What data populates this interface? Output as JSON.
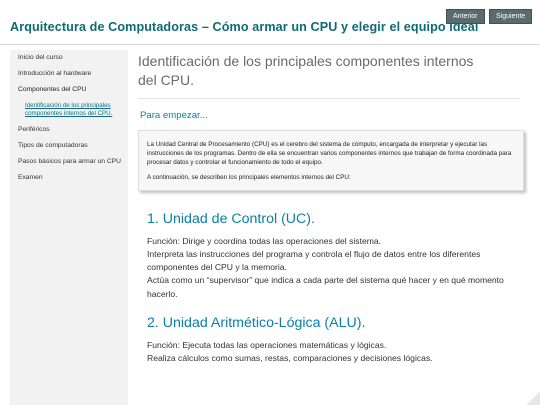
{
  "header": {
    "title": "Arquitectura de Computadoras – Cómo armar un CPU y elegir el equipo ideal",
    "prev_label": "Anterior",
    "next_label": "Siguiente"
  },
  "sidebar": {
    "items": [
      {
        "label": "Inicio del curso"
      },
      {
        "label": "Introducción al hardware"
      },
      {
        "label": "Componentes del CPU"
      },
      {
        "label": "Identificación de los principales componentes internos del CPU."
      },
      {
        "label": "Periféricos"
      },
      {
        "label": "Tipos de computadoras"
      },
      {
        "label": "Pasos básicos para armar un CPU"
      },
      {
        "label": "Examen"
      }
    ]
  },
  "main": {
    "page_title": "Identificación de los principales componentes internos del CPU.",
    "start_heading": "Para empezar...",
    "intro": [
      "La Unidad Central de Procesamiento (CPU) es el cerebro del sistema de cómputo, encargada de interpretar y ejecutar las instrucciones de los programas. Dentro de ella se encuentran varios componentes internos que trabajan de forma coordinada para procesar datos y controlar el funcionamiento de todo el equipo.",
      "A continuación, se describen los principales elementos internos del CPU:"
    ],
    "sections": [
      {
        "heading": "1. Unidad de Control (UC).",
        "lines": [
          "Función: Dirige y coordina todas las operaciones del sistema.",
          "Interpreta las instrucciones del programa y controla el flujo de datos entre los diferentes componentes del CPU y la memoria.",
          "Actúa como un “supervisor” que indica a cada parte del sistema qué hacer y en qué momento hacerlo."
        ]
      },
      {
        "heading": "2. Unidad Aritmético-Lógica (ALU).",
        "lines": [
          "Función: Ejecuta todas las operaciones matemáticas y lógicas.",
          "Realiza cálculos como sumas, restas, comparaciones y decisiones lógicas."
        ]
      }
    ]
  }
}
